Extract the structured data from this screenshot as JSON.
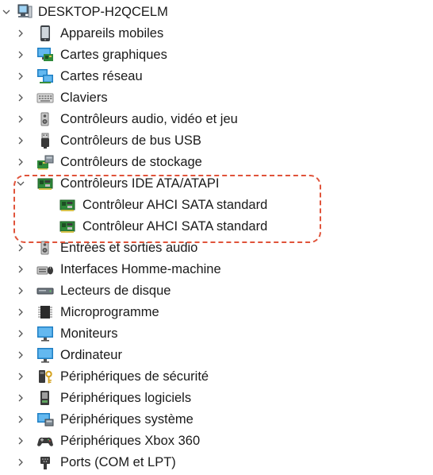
{
  "root": {
    "label": "DESKTOP-H2QCELM",
    "icon": "computer-icon"
  },
  "categories": [
    {
      "label": "Appareils mobiles",
      "icon": "mobile-device-icon"
    },
    {
      "label": "Cartes graphiques",
      "icon": "display-adapter-icon"
    },
    {
      "label": "Cartes réseau",
      "icon": "network-adapter-icon"
    },
    {
      "label": "Claviers",
      "icon": "keyboard-icon"
    },
    {
      "label": "Contrôleurs audio, vidéo et jeu",
      "icon": "speaker-icon"
    },
    {
      "label": "Contrôleurs de bus USB",
      "icon": "usb-icon"
    },
    {
      "label": "Contrôleurs de stockage",
      "icon": "storage-controller-icon"
    },
    {
      "label": "Contrôleurs IDE ATA/ATAPI",
      "icon": "ide-controller-icon",
      "expanded": true,
      "children": [
        {
          "label": "Contrôleur AHCI SATA standard",
          "icon": "ide-controller-icon"
        },
        {
          "label": "Contrôleur AHCI SATA standard",
          "icon": "ide-controller-icon"
        }
      ]
    },
    {
      "label": "Entrées et sorties audio",
      "icon": "speaker-icon"
    },
    {
      "label": "Interfaces Homme-machine",
      "icon": "hid-icon"
    },
    {
      "label": "Lecteurs de disque",
      "icon": "disk-drive-icon"
    },
    {
      "label": "Microprogramme",
      "icon": "firmware-chip-icon"
    },
    {
      "label": "Moniteurs",
      "icon": "monitor-icon"
    },
    {
      "label": "Ordinateur",
      "icon": "monitor-icon"
    },
    {
      "label": "Périphériques de sécurité",
      "icon": "security-key-icon"
    },
    {
      "label": "Périphériques logiciels",
      "icon": "software-device-icon"
    },
    {
      "label": "Périphériques système",
      "icon": "system-device-icon"
    },
    {
      "label": "Périphériques Xbox 360",
      "icon": "gamepad-icon"
    },
    {
      "label": "Ports (COM et LPT)",
      "icon": "port-icon"
    }
  ],
  "colors": {
    "highlight": "#e0533a",
    "chevron": "#555555"
  }
}
